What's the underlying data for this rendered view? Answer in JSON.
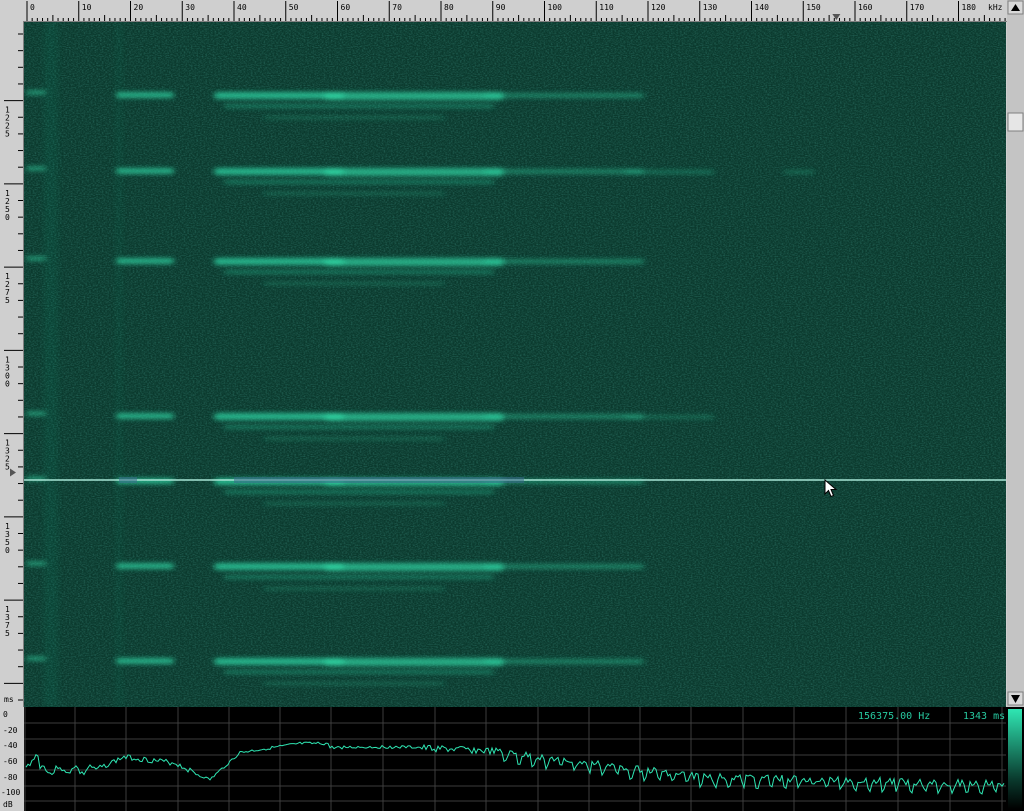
{
  "freq_axis": {
    "unit": "kHz",
    "labels": [
      "0",
      "10",
      "20",
      "30",
      "40",
      "50",
      "60",
      "70",
      "80",
      "90",
      "100",
      "110",
      "120",
      "130",
      "140",
      "150",
      "160",
      "170",
      "180"
    ]
  },
  "time_axis": {
    "unit": "ms",
    "labels": [
      "1225",
      "1250",
      "1275",
      "1300",
      "1325",
      "1350",
      "1375"
    ]
  },
  "analyzer": {
    "db_unit": "dB",
    "db_labels": [
      "0",
      "-20",
      "-40",
      "-60",
      "-80",
      "-100"
    ],
    "readout_freq": "156375.00 Hz",
    "readout_time": "1343 ms"
  },
  "colors": {
    "background": "#0d3f33",
    "signal": "#2fd6a4",
    "trace": "#2fe6b3",
    "cursor": "#a8e6d6"
  },
  "icons": {
    "scroll_up": "triangle-up",
    "scroll_down": "triangle-down",
    "freq_marker": "triangle-down",
    "time_marker": "triangle-right",
    "pointer": "mouse-arrow"
  },
  "cursor": {
    "freq_khz": 156.4,
    "time_ms": 1343
  }
}
